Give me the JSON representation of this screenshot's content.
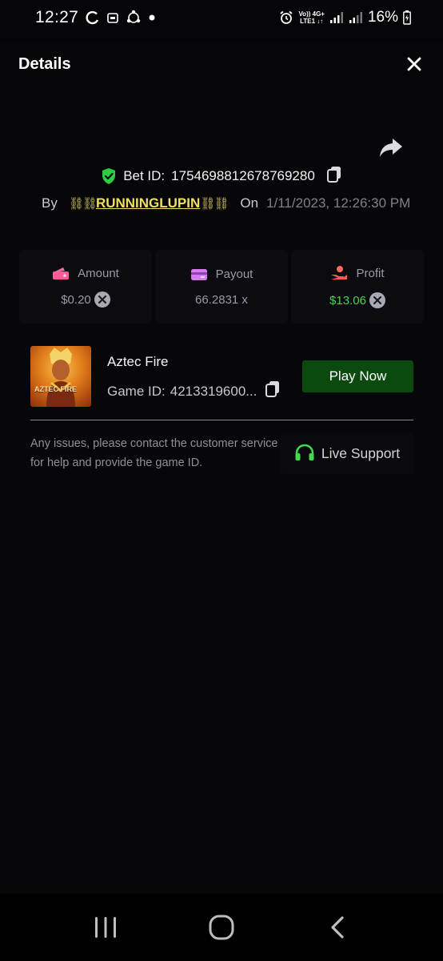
{
  "status_bar": {
    "time": "12:27",
    "network_line1": "Vo)) 4G+",
    "network_line2": "LTE1 ↓↑",
    "battery": "16%"
  },
  "header": {
    "title": "Details",
    "close_icon": "close-icon"
  },
  "bet": {
    "id_label": "Bet ID:",
    "id_value": "1754698812678769280",
    "by_label": "By",
    "username": "RUNNINGLUPIN",
    "chain_left": "⛓⛓",
    "chain_right": "⛓⛓",
    "on_label": "On",
    "datetime": "1/11/2023, 12:26:30 PM"
  },
  "stats": {
    "amount": {
      "label": "Amount",
      "value": "$0.20",
      "icon": "wallet-icon"
    },
    "payout": {
      "label": "Payout",
      "value": "66.2831 x",
      "icon": "card-icon"
    },
    "profit": {
      "label": "Profit",
      "value": "$13.06",
      "icon": "hand-coin-icon"
    }
  },
  "game": {
    "name": "Aztec Fire",
    "id_label": "Game ID:",
    "id_value": "4213319600...",
    "thumb_text": "AZTEC FIRE",
    "play_label": "Play Now"
  },
  "support": {
    "help_text": "Any issues, please contact the customer service for help and provide the game ID.",
    "button_label": "Live Support"
  },
  "colors": {
    "accent_green": "#48d34e",
    "play_button": "#0b4a0f",
    "username": "#f0e05a",
    "badge_green": "#2ecc40"
  }
}
